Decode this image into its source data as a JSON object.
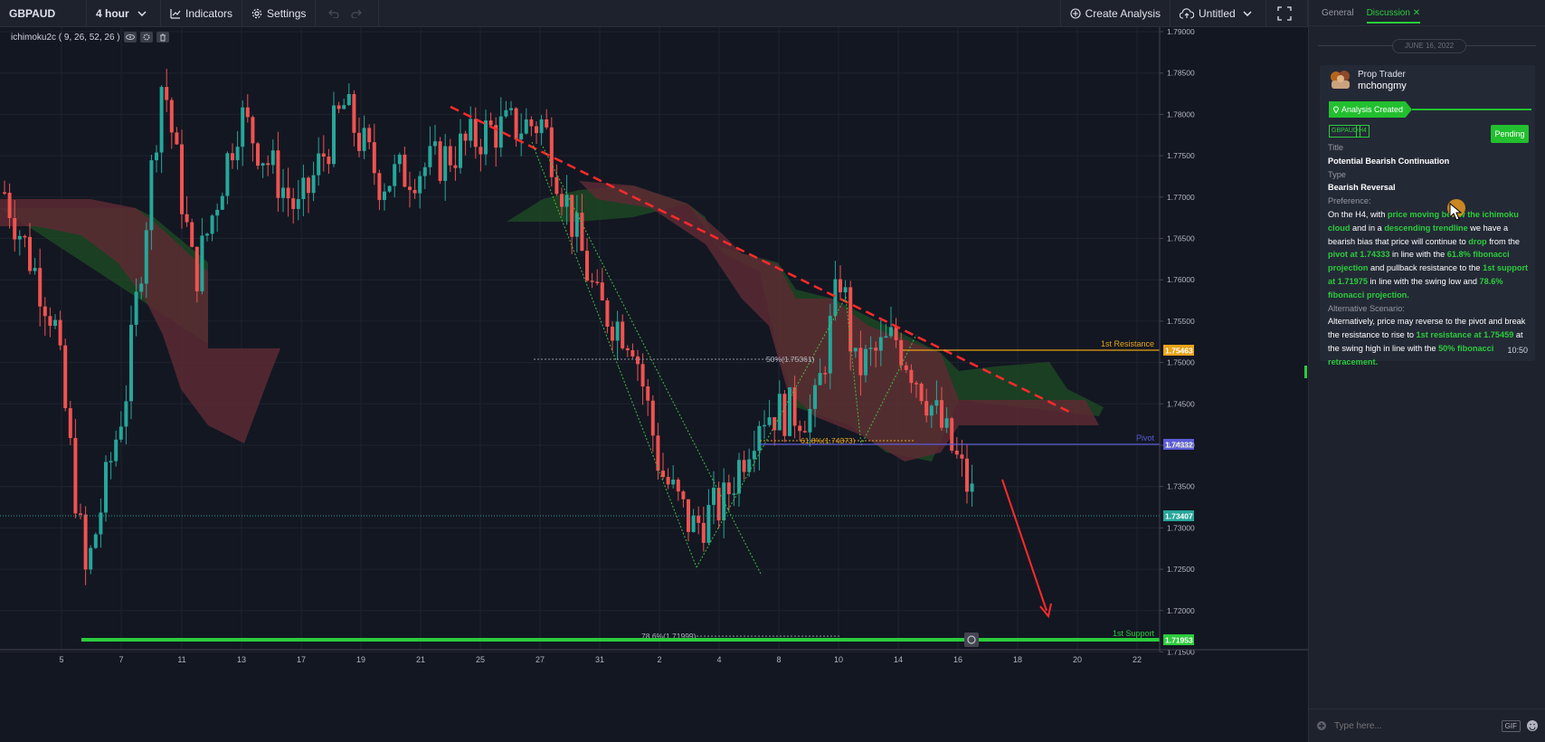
{
  "toolbar": {
    "symbol": "GBPAUD",
    "interval": "4 hour",
    "indicators_label": "Indicators",
    "settings_label": "Settings",
    "create_analysis_label": "Create Analysis",
    "layout_name": "Untitled"
  },
  "indicator": {
    "label": "ichimoku2c ( 9, 26, 52, 26 )"
  },
  "chart": {
    "price_axis": [
      "1.79000",
      "1.78500",
      "1.78000",
      "1.77500",
      "1.77000",
      "1.76500",
      "1.76000",
      "1.75500",
      "1.75000",
      "1.74500",
      "1.74000",
      "1.73500",
      "1.73000",
      "1.72500",
      "1.72000",
      "1.71500"
    ],
    "time_axis": [
      "5",
      "7",
      "11",
      "13",
      "17",
      "19",
      "21",
      "25",
      "27",
      "31",
      "2",
      "4",
      "8",
      "10",
      "14",
      "16",
      "18",
      "20",
      "22"
    ],
    "current_price": "1.73407",
    "levels": [
      {
        "name": "1st Resistance",
        "price": "1.75463",
        "color": "#e8a317"
      },
      {
        "name": "Pivot",
        "price": "1.74332",
        "color": "#5b5bd6"
      },
      {
        "name": "1st Support",
        "price": "1.71953",
        "color": "#2bcc3c"
      }
    ],
    "fib_labels": {
      "fib50": "50%(1.75361)",
      "fib618": "61.8%(1.74373)",
      "fib786": "78.6%(1.71999)"
    },
    "colors": {
      "up": "#26a69a",
      "down": "#ef5350",
      "trendline": "#ff2a2a",
      "cloud_bull": "#1f4d24",
      "cloud_bear": "#5c2a32"
    }
  },
  "panel": {
    "tabs": [
      "General",
      "Discussion"
    ],
    "active_tab": "Discussion",
    "date": "JUNE 16, 2022",
    "post": {
      "role": "Prop Trader",
      "username": "mchongmy",
      "status": "Analysis Created",
      "tags": [
        "GBPAUD",
        "H4"
      ],
      "state": "Pending",
      "title_label": "Title",
      "title": "Potential Bearish Continuation",
      "type_label": "Type",
      "type": "Bearish Reversal",
      "preference_label": "Preference:",
      "pref": {
        "t1": "On the H4, with ",
        "h1": "price moving below the ichimoku cloud",
        "t2": " and in a ",
        "h2": "descending trendline",
        "t3": " we have a bearish bias that price will continue to ",
        "h3": "drop",
        "t4": " from the ",
        "h4": "pivot at 1.74333",
        "t5": " in line with the ",
        "h5": "61.8% fibonacci projection",
        "t6": " and pullback resistance to the ",
        "h6": "1st support at 1.71975",
        "t7": " in line with the swing low and ",
        "h7": "78.6% fibonacci projection."
      },
      "alt_label": "Alternative Scenario:",
      "alt": {
        "t1": "Alternatively, price may reverse to the pivot and break the resistance to rise to ",
        "h1": "1st resistance at 1.75459",
        "t2": " at the swing high in line with the ",
        "h2": "50% fibonacci retracement."
      },
      "time": "10:50"
    },
    "input_placeholder": "Type here...",
    "gif_label": "GIF"
  }
}
